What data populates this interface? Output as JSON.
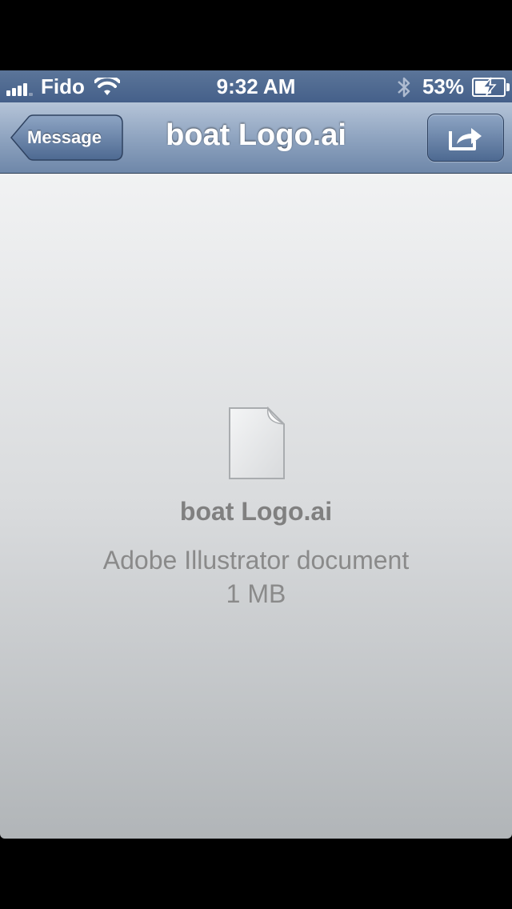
{
  "status_bar": {
    "carrier": "Fido",
    "time": "9:32 AM",
    "battery_percent": "53%",
    "battery_level": 0.53,
    "icons": [
      "signal-icon",
      "wifi-icon",
      "bluetooth-icon",
      "battery-icon"
    ]
  },
  "nav_bar": {
    "back_label": "Message",
    "title": "boat Logo.ai",
    "share_icon": "share-icon"
  },
  "file": {
    "icon": "document-icon",
    "name": "boat Logo.ai",
    "type": "Adobe Illustrator document",
    "size": "1 MB"
  },
  "colors": {
    "nav_tint": "#6e87a9",
    "status_bar": "#4a6590",
    "content_text": "#808080"
  }
}
